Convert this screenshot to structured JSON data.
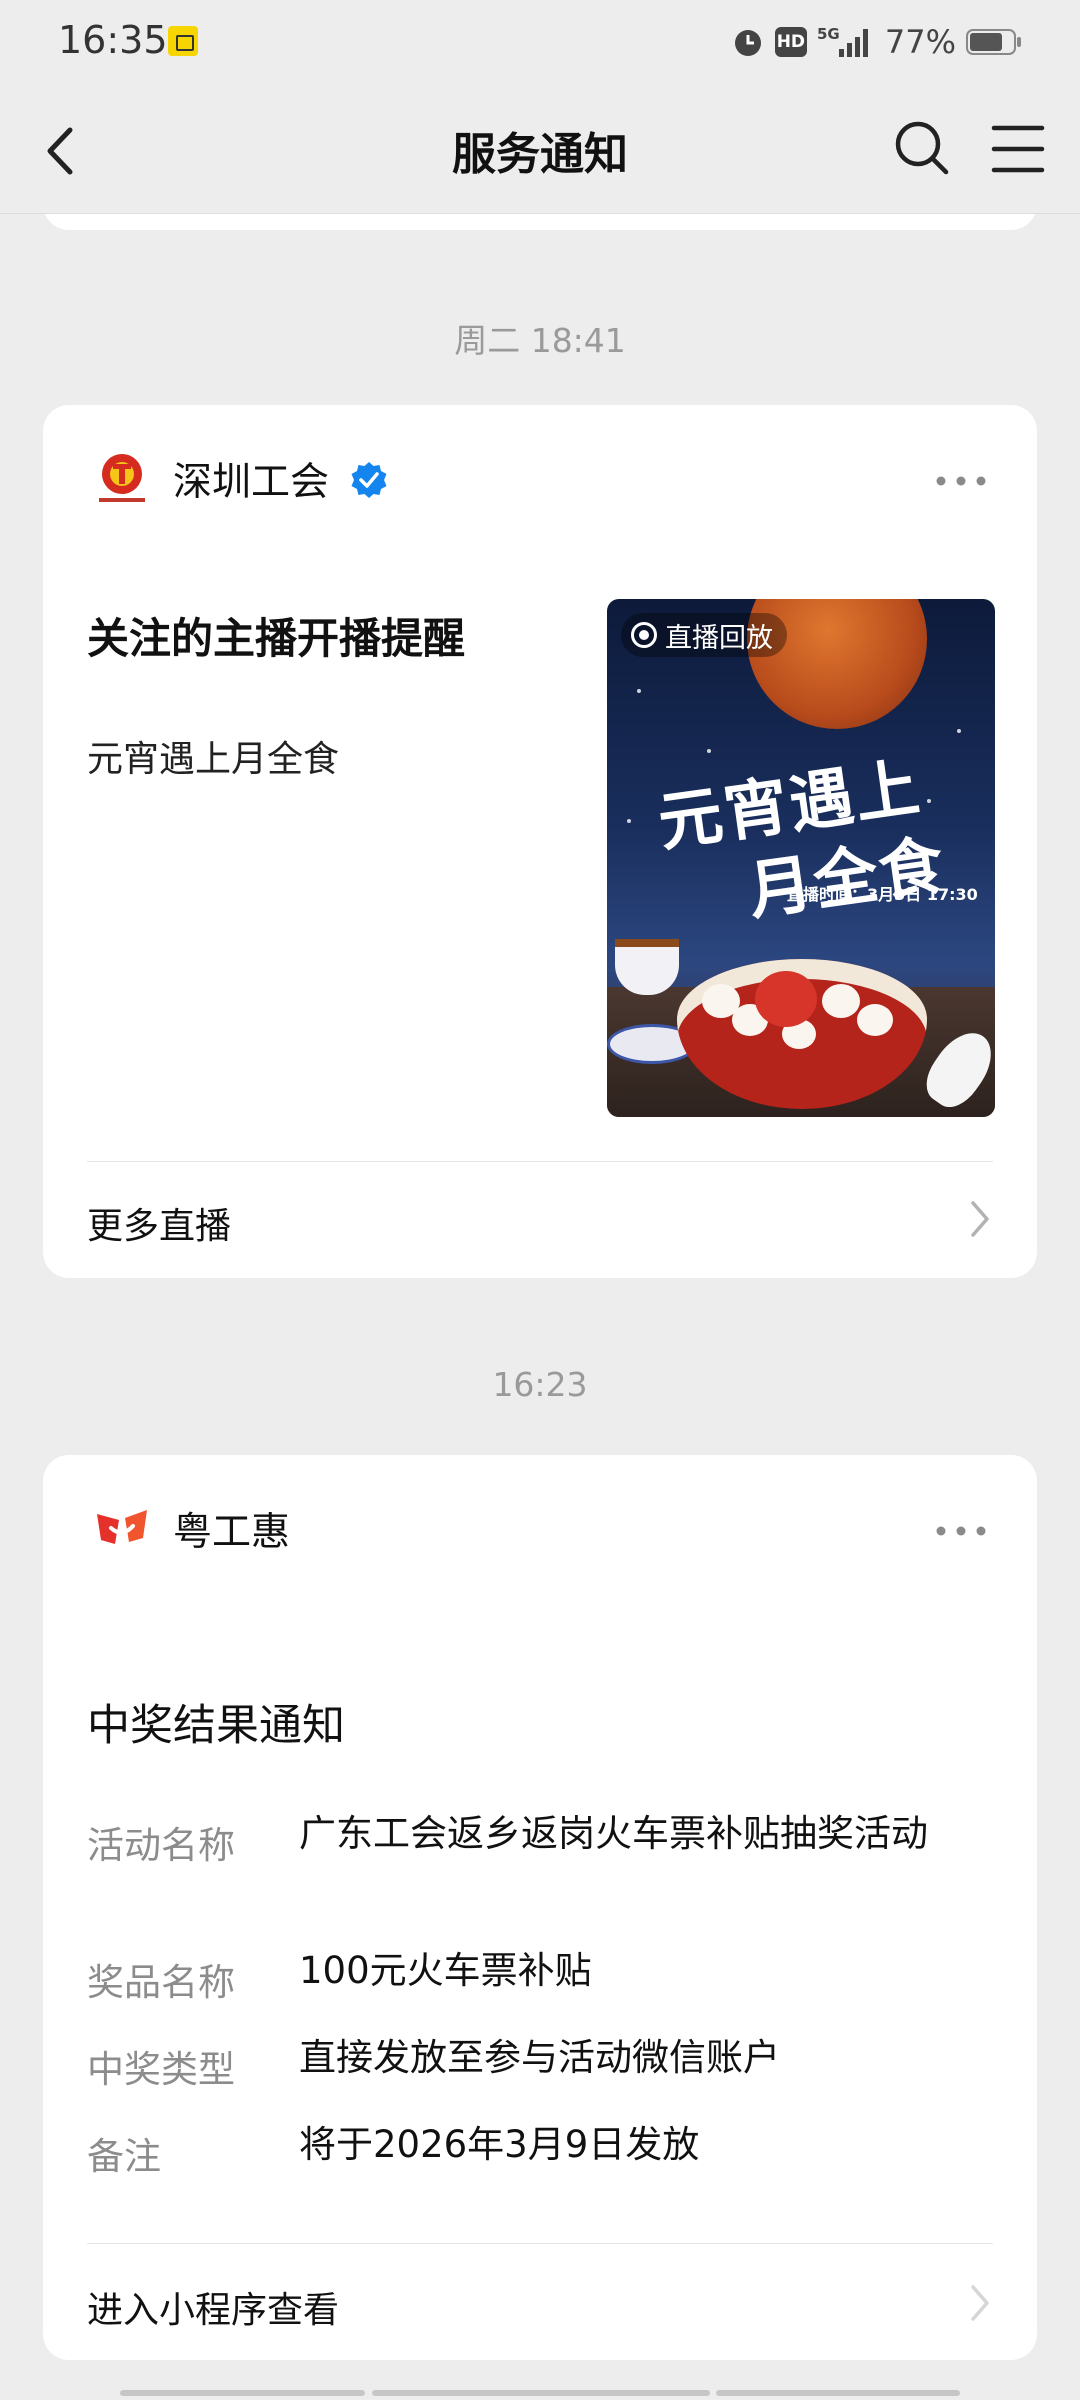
{
  "status_bar": {
    "time": "16:35",
    "network": "5G",
    "hd_label": "HD",
    "battery": "77%"
  },
  "nav": {
    "title": "服务通知"
  },
  "messages": [
    {
      "timestamp": "周二 18:41",
      "source_name": "深圳工会",
      "verified": true,
      "title": "关注的主播开播提醒",
      "subtitle": "元宵遇上月全食",
      "thumbnail": {
        "badge": "直播回放",
        "headline_line1": "元宵遇上",
        "headline_line2": "月全食",
        "airtime": "直播时间：3月3日 17:30"
      },
      "footer_link": "更多直播"
    },
    {
      "timestamp": "16:23",
      "source_name": "粤工惠",
      "title": "中奖结果通知",
      "fields": [
        {
          "label": "活动名称",
          "value": "广东工会返乡返岗火车票补贴抽奖活动"
        },
        {
          "label": "奖品名称",
          "value": "100元火车票补贴"
        },
        {
          "label": "中奖类型",
          "value": "直接发放至参与活动微信账户"
        },
        {
          "label": "备注",
          "value": "将于2026年3月9日发放"
        }
      ],
      "footer_link": "进入小程序查看"
    }
  ],
  "colors": {
    "background": "#ededed",
    "card": "#ffffff",
    "verified_blue": "#1485ee",
    "label_gray": "#8c8c8c"
  }
}
